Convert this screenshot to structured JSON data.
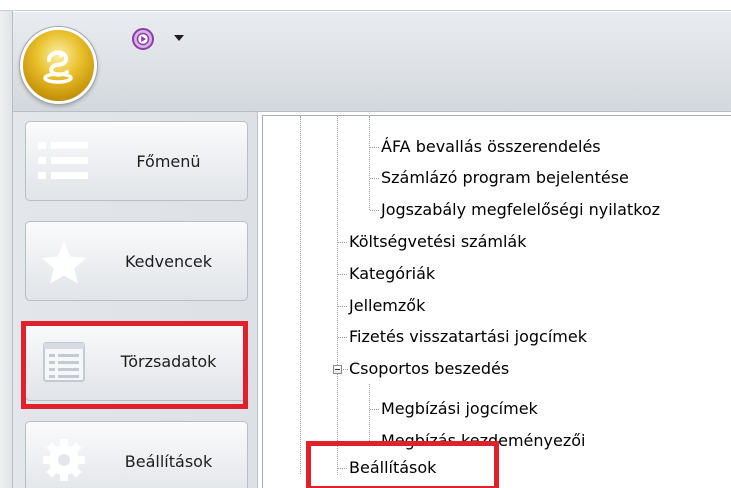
{
  "navigation": {
    "items": [
      {
        "id": "fomenu",
        "label": "Főmenü",
        "icon": "list-icon"
      },
      {
        "id": "kedvencek",
        "label": "Kedvencek",
        "icon": "star-icon"
      },
      {
        "id": "torzsadatok",
        "label": "Törzsadatok",
        "icon": "form-icon",
        "highlighted": true
      },
      {
        "id": "beallitasok",
        "label": "Beállítások",
        "icon": "gear-icon"
      }
    ]
  },
  "tree": {
    "items": [
      {
        "label": "ÁFA bevallás összerendelés",
        "level": 2
      },
      {
        "label": "Számlázó program bejelentése",
        "level": 2
      },
      {
        "label": "Jogszabály megfelelőségi nyilatkoz",
        "level": 2
      },
      {
        "label": "Költségvetési számlák",
        "level": 1
      },
      {
        "label": "Kategóriák",
        "level": 1
      },
      {
        "label": "Jellemzők",
        "level": 1
      },
      {
        "label": "Fizetés visszatartási jogcímek",
        "level": 1
      },
      {
        "label": "Csoportos beszedés",
        "level": 1,
        "expanded": true
      },
      {
        "label": "Megbízási jogcímek",
        "level": 2
      },
      {
        "label": "Megbízás kezdeményezői",
        "level": 2
      },
      {
        "label": "Beállítások",
        "level": 1,
        "highlighted": true
      }
    ]
  },
  "colors": {
    "highlight": "#e0202a",
    "orb": "#e3b424",
    "qat_button": "#8a3fa6"
  }
}
